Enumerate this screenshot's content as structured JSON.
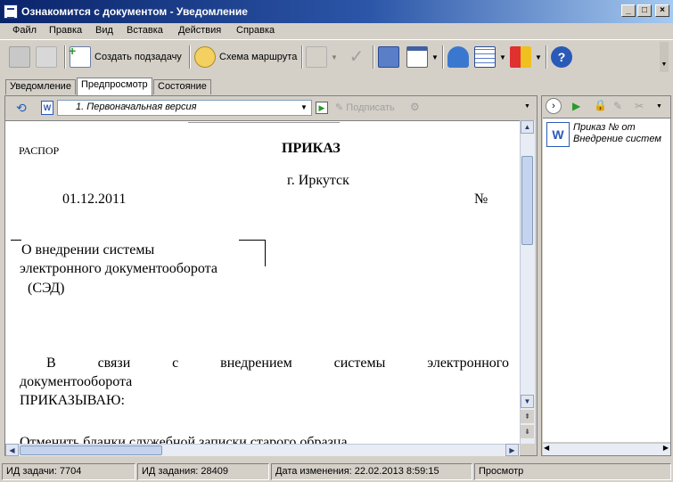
{
  "window": {
    "title": "Ознакомится с документом - Уведомление"
  },
  "menu": [
    "Файл",
    "Правка",
    "Вид",
    "Вставка",
    "Действия",
    "Справка"
  ],
  "toolbar": {
    "create_subtask": "Создать подзадачу",
    "route_scheme": "Схема маршрута"
  },
  "tabs": [
    "Уведомление",
    "Предпросмотр",
    "Состояние"
  ],
  "doc_toolbar": {
    "version": "1. Первоначальная версия",
    "sign": "Подписать"
  },
  "document": {
    "left_header": "РАСПОР",
    "title": "ПРИКАЗ",
    "city": "г. Иркутск",
    "date": "01.12.2011",
    "number_sign": "№",
    "subject_1": "О внедрении системы",
    "subject_2": "электронного документооборота",
    "subject_3": "(СЭД)",
    "body_1_words": [
      "В",
      "связи",
      "с",
      "внедрением",
      "системы",
      "электронного"
    ],
    "body_2": "документооборота",
    "order": "ПРИКАЗЫВАЮ:",
    "cut_line": "Отменить бланки служебной записки старого образца"
  },
  "attachments": [
    {
      "line1": "Приказ №  от",
      "line2": "Внедрение систем"
    }
  ],
  "status": {
    "task_id": "ИД задачи: 7704",
    "assignment_id": "ИД задания: 28409",
    "modified": "Дата изменения: 22.02.2013 8:59:15",
    "mode": "Просмотр"
  }
}
